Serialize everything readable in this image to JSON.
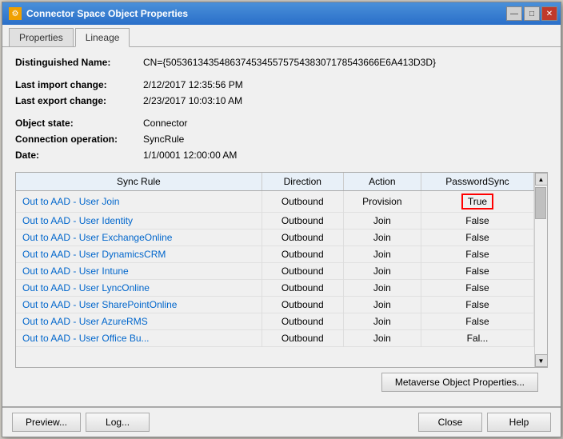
{
  "window": {
    "title": "Connector Space Object Properties",
    "close_btn": "✕",
    "minimize_btn": "—",
    "maximize_btn": "□"
  },
  "tabs": [
    {
      "label": "Properties",
      "active": false
    },
    {
      "label": "Lineage",
      "active": true
    }
  ],
  "fields": {
    "distinguished_name_label": "Distinguished Name:",
    "distinguished_name_value": "CN={5053613435486374534557575438307178543666E6A413D3D}",
    "last_import_label": "Last import change:",
    "last_import_value": "2/12/2017 12:35:56 PM",
    "last_export_label": "Last export change:",
    "last_export_value": "2/23/2017 10:03:10 AM",
    "object_state_label": "Object state:",
    "object_state_value": "Connector",
    "connection_operation_label": "Connection operation:",
    "connection_operation_value": "SyncRule",
    "date_label": "Date:",
    "date_value": "1/1/0001 12:00:00 AM"
  },
  "table": {
    "columns": [
      "Sync Rule",
      "Direction",
      "Action",
      "PasswordSync"
    ],
    "rows": [
      {
        "sync_rule": "Out to AAD - User Join",
        "direction": "Outbound",
        "action": "Provision",
        "password_sync": "True",
        "highlight": true
      },
      {
        "sync_rule": "Out to AAD - User Identity",
        "direction": "Outbound",
        "action": "Join",
        "password_sync": "False",
        "highlight": false
      },
      {
        "sync_rule": "Out to AAD - User ExchangeOnline",
        "direction": "Outbound",
        "action": "Join",
        "password_sync": "False",
        "highlight": false
      },
      {
        "sync_rule": "Out to AAD - User DynamicsCRM",
        "direction": "Outbound",
        "action": "Join",
        "password_sync": "False",
        "highlight": false
      },
      {
        "sync_rule": "Out to AAD - User Intune",
        "direction": "Outbound",
        "action": "Join",
        "password_sync": "False",
        "highlight": false
      },
      {
        "sync_rule": "Out to AAD - User LyncOnline",
        "direction": "Outbound",
        "action": "Join",
        "password_sync": "False",
        "highlight": false
      },
      {
        "sync_rule": "Out to AAD - User SharePointOnline",
        "direction": "Outbound",
        "action": "Join",
        "password_sync": "False",
        "highlight": false
      },
      {
        "sync_rule": "Out to AAD - User AzureRMS",
        "direction": "Outbound",
        "action": "Join",
        "password_sync": "False",
        "highlight": false
      },
      {
        "sync_rule": "Out to AAD - User Office Bu...",
        "direction": "Outbound",
        "action": "Join",
        "password_sync": "Fal...",
        "highlight": false
      }
    ]
  },
  "buttons": {
    "metaverse_object_properties": "Metaverse Object Properties...",
    "preview": "Preview...",
    "log": "Log...",
    "close": "Close",
    "help": "Help"
  }
}
